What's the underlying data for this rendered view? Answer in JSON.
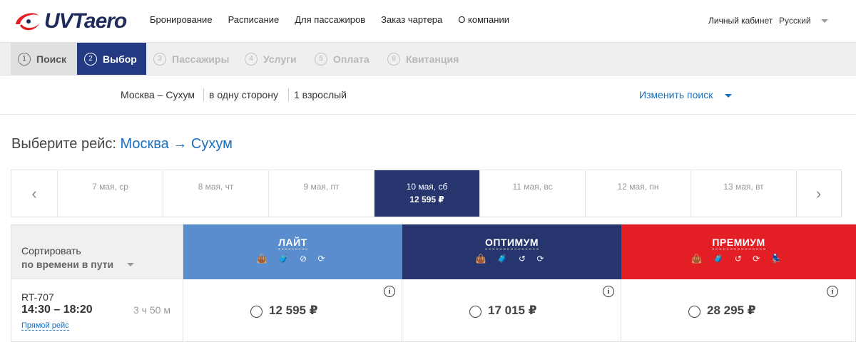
{
  "header": {
    "logo_text": "UVTaero",
    "nav": [
      "Бронирование",
      "Расписание",
      "Для пассажиров",
      "Заказ чартера",
      "О компании"
    ],
    "account": "Личный кабинет",
    "language": "Русский"
  },
  "steps": [
    {
      "num": "1",
      "label": "Поиск",
      "state": "done"
    },
    {
      "num": "2",
      "label": "Выбор",
      "state": "active"
    },
    {
      "num": "3",
      "label": "Пассажиры",
      "state": "pending"
    },
    {
      "num": "4",
      "label": "Услуги",
      "state": "pending"
    },
    {
      "num": "5",
      "label": "Оплата",
      "state": "pending"
    },
    {
      "num": "6",
      "label": "Квитанция",
      "state": "pending"
    }
  ],
  "summary": {
    "route": "Москва – Сухум",
    "trip_type": "в одну сторону",
    "passengers": "1 взрослый",
    "change_search": "Изменить поиск"
  },
  "heading": {
    "prefix": "Выберите рейс:",
    "from": "Москва",
    "arrow": "→",
    "to": "Сухум"
  },
  "dates": [
    {
      "label": "7 мая, ср",
      "price": ""
    },
    {
      "label": "8 мая, чт",
      "price": ""
    },
    {
      "label": "9 мая, пт",
      "price": ""
    },
    {
      "label": "10 мая, сб",
      "price": "12 595 ₽",
      "selected": true
    },
    {
      "label": "11 мая, вс",
      "price": ""
    },
    {
      "label": "12 мая, пн",
      "price": ""
    },
    {
      "label": "13 мая, вт",
      "price": ""
    }
  ],
  "sort": {
    "label": "Сортировать",
    "value": "по времени в пути"
  },
  "fares": [
    {
      "name": "ЛАЙТ",
      "color": "#5a8dcd",
      "icons": "👜 🧳 ⊘ ⟳"
    },
    {
      "name": "ОПТИМУМ",
      "color": "#26356e",
      "icons": "👜 🧳 ↺ ⟳"
    },
    {
      "name": "ПРЕМИУМ",
      "color": "#e31e24",
      "icons": "👜 🧳 ↺ ⟳ 💺"
    }
  ],
  "flight": {
    "number": "RT-707",
    "time": "14:30 – 18:20",
    "duration": "3 ч 50 м",
    "direct": "Прямой рейс",
    "prices": [
      "12 595 ₽",
      "17 015 ₽",
      "28 295 ₽"
    ]
  },
  "colors": {
    "brand_red": "#e31e24",
    "brand_navy": "#26356e",
    "link_blue": "#1b6fbf"
  }
}
